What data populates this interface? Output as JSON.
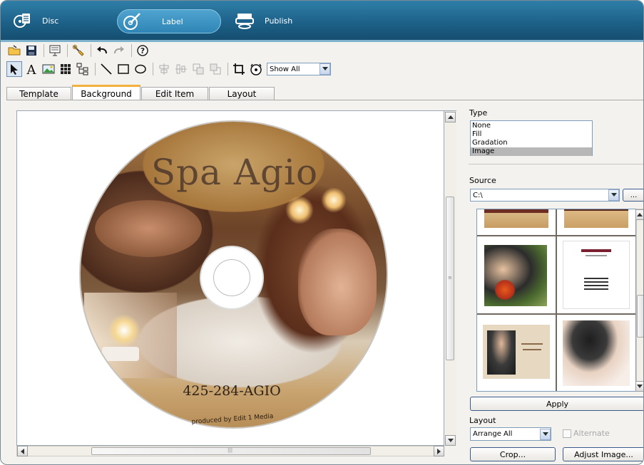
{
  "modes": {
    "disc": "Disc",
    "label": "Label",
    "publish": "Publish"
  },
  "toolbar": {
    "view_filter": "Show All"
  },
  "tabs": [
    {
      "label": "Template"
    },
    {
      "label": "Background",
      "active": true
    },
    {
      "label": "Edit Item"
    },
    {
      "label": "Layout"
    }
  ],
  "disc": {
    "title": "Spa Agio",
    "phone": "425-284-AGIO",
    "credit": "produced by Edit 1 Media"
  },
  "panel": {
    "type_label": "Type",
    "type_options": [
      "None",
      "Fill",
      "Gradation",
      "Image"
    ],
    "type_selected": "Image",
    "source_label": "Source",
    "source_value": "C:\\",
    "browse_label": "...",
    "apply_label": "Apply",
    "layout_label": "Layout",
    "layout_value": "Arrange All",
    "alternate_label": "Alternate",
    "crop_label": "Crop...",
    "adjust_label": "Adjust Image..."
  },
  "colors": {
    "mode_bar": "#1c5f86",
    "active_tab_accent": "#f3b13c",
    "selection": "#b7b7b7"
  }
}
